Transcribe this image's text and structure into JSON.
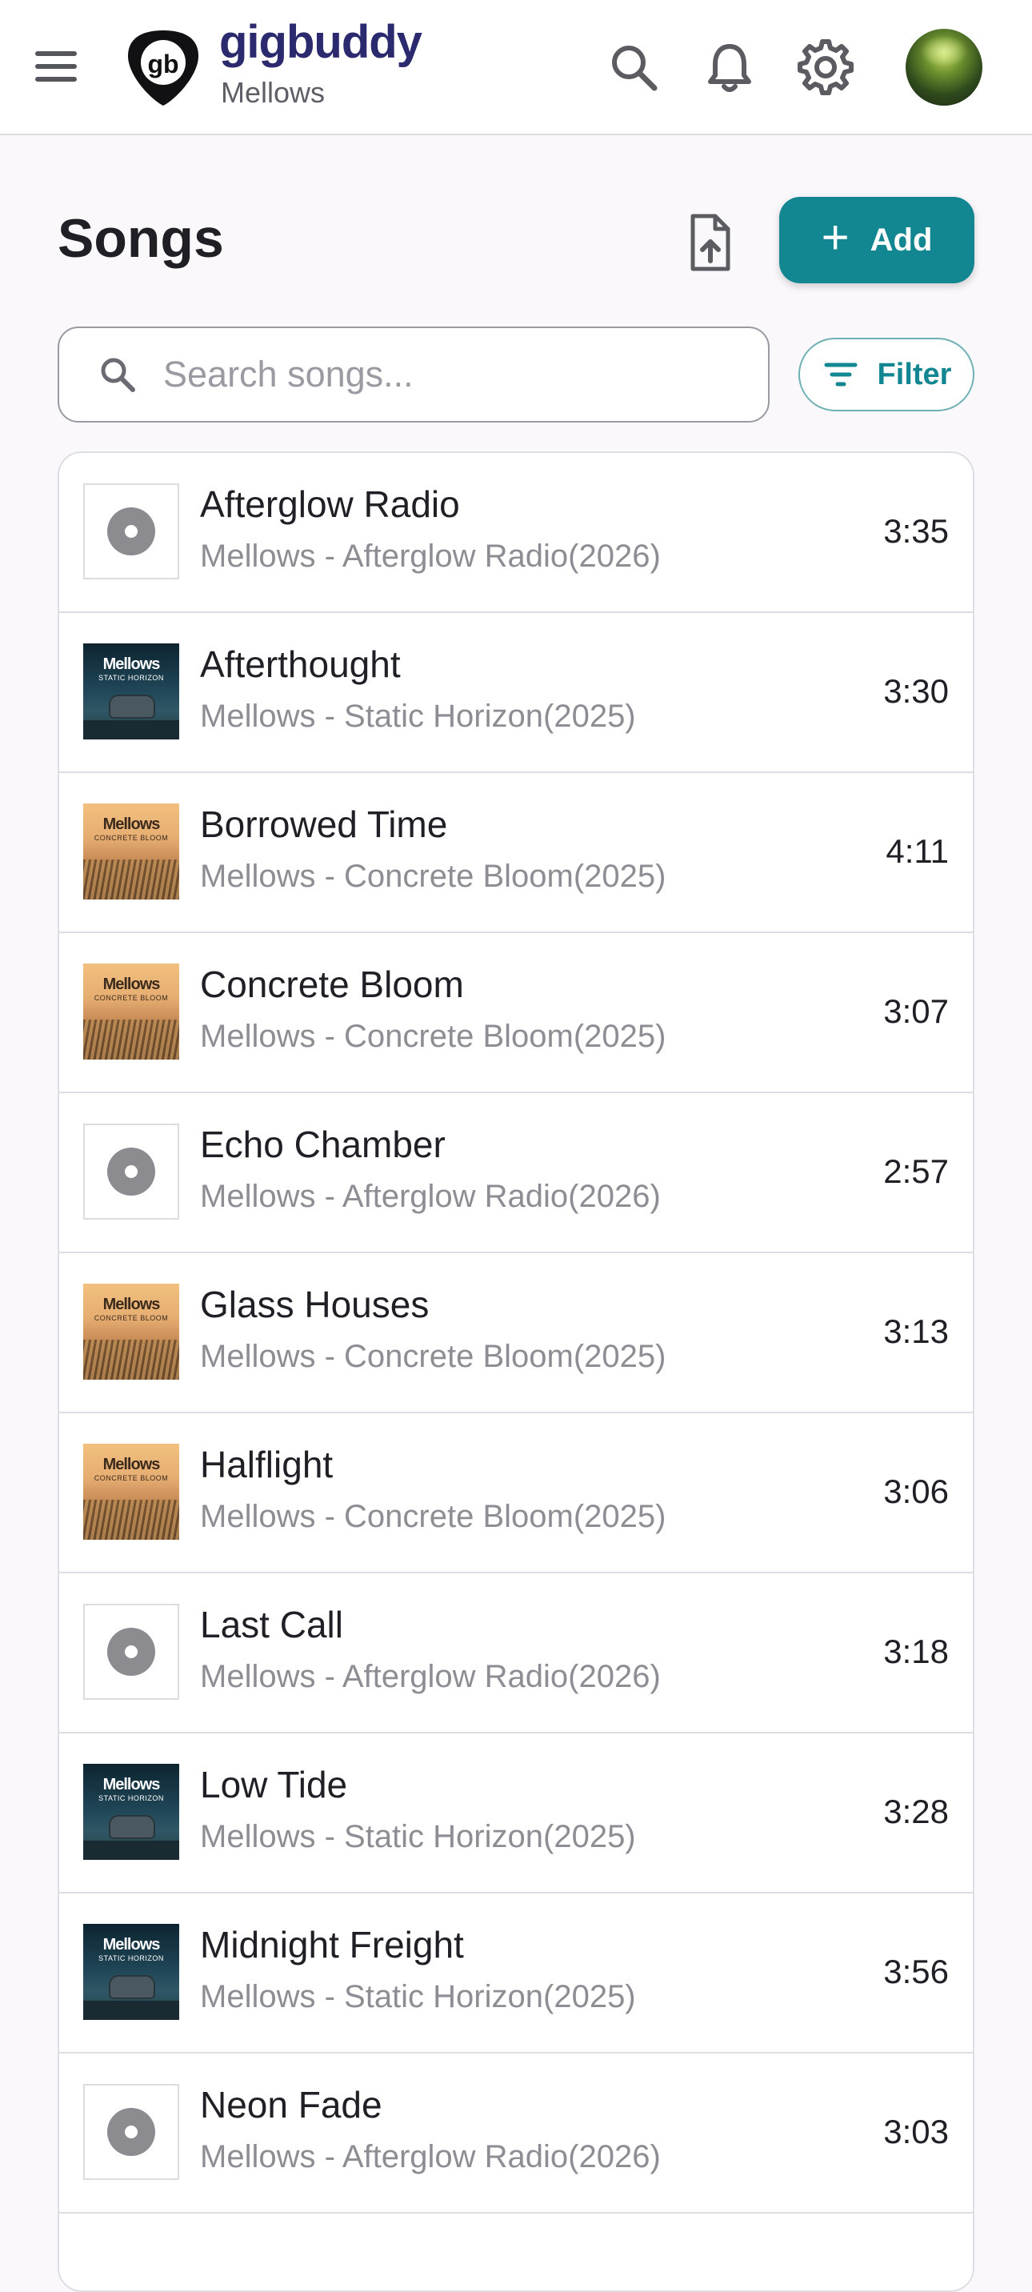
{
  "header": {
    "brand": "gigbuddy",
    "band": "Mellows",
    "icons": [
      "menu-icon",
      "logo-pick-icon",
      "search-icon",
      "bell-icon",
      "gear-icon",
      "avatar"
    ]
  },
  "page": {
    "title": "Songs",
    "add_label": "Add",
    "add_icon": "+",
    "filter_label": "Filter"
  },
  "search": {
    "placeholder": "Search songs..."
  },
  "colors": {
    "accent": "#138791",
    "brand": "#2c2a6e",
    "muted": "#8e8d94"
  },
  "artwork": {
    "static": {
      "title": "Mellows",
      "subtitle": "STATIC HORIZON"
    },
    "concrete": {
      "title": "Mellows",
      "subtitle": "CONCRETE BLOOM"
    }
  },
  "songs": [
    {
      "title": "Afterglow Radio",
      "meta": "Mellows - Afterglow Radio(2026)",
      "duration": "3:35",
      "art": "none"
    },
    {
      "title": "Afterthought",
      "meta": "Mellows - Static Horizon(2025)",
      "duration": "3:30",
      "art": "static"
    },
    {
      "title": "Borrowed Time",
      "meta": "Mellows - Concrete Bloom(2025)",
      "duration": "4:11",
      "art": "concrete"
    },
    {
      "title": "Concrete Bloom",
      "meta": "Mellows - Concrete Bloom(2025)",
      "duration": "3:07",
      "art": "concrete"
    },
    {
      "title": "Echo Chamber",
      "meta": "Mellows - Afterglow Radio(2026)",
      "duration": "2:57",
      "art": "none"
    },
    {
      "title": "Glass Houses",
      "meta": "Mellows - Concrete Bloom(2025)",
      "duration": "3:13",
      "art": "concrete"
    },
    {
      "title": "Halflight",
      "meta": "Mellows - Concrete Bloom(2025)",
      "duration": "3:06",
      "art": "concrete"
    },
    {
      "title": "Last Call",
      "meta": "Mellows - Afterglow Radio(2026)",
      "duration": "3:18",
      "art": "none"
    },
    {
      "title": "Low Tide",
      "meta": "Mellows - Static Horizon(2025)",
      "duration": "3:28",
      "art": "static"
    },
    {
      "title": "Midnight Freight",
      "meta": "Mellows - Static Horizon(2025)",
      "duration": "3:56",
      "art": "static"
    },
    {
      "title": "Neon Fade",
      "meta": "Mellows - Afterglow Radio(2026)",
      "duration": "3:03",
      "art": "none"
    }
  ]
}
